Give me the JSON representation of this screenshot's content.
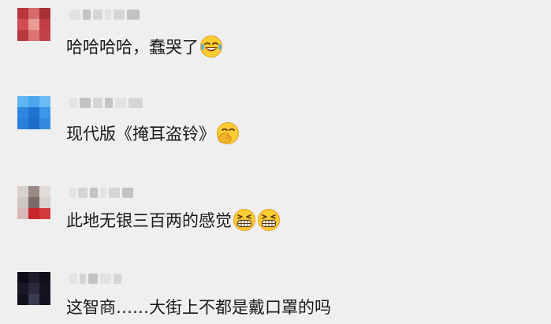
{
  "comments": [
    {
      "text": "哈哈哈哈，蠢哭了",
      "emojis": [
        "laugh-cry-emoji"
      ]
    },
    {
      "text": "现代版《掩耳盗铃》",
      "emojis": [
        "face-with-hand-over-mouth-emoji"
      ]
    },
    {
      "text": "此地无银三百两的感觉",
      "emojis": [
        "grinning-squinting-emoji",
        "grinning-squinting-emoji"
      ]
    },
    {
      "text": "这智商……大街上不都是戴口罩的吗",
      "emojis": []
    }
  ],
  "colors": {
    "background": "#efefef",
    "text": "#1a1a1a",
    "emoji_yellow": "#ffcc33",
    "emoji_outline": "#e0a020"
  }
}
